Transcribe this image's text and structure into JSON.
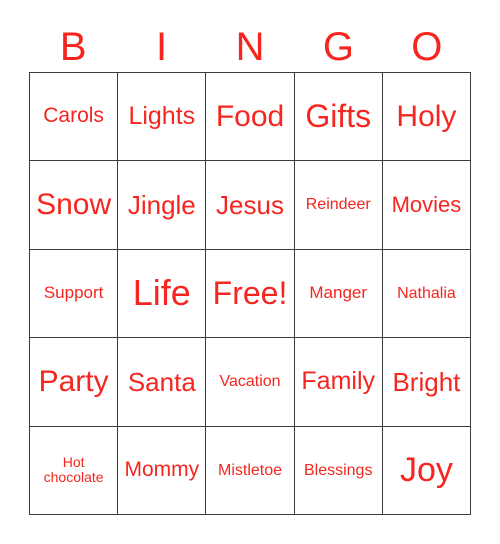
{
  "card": {
    "title": "BINGO Card",
    "text_color": "#f4261f",
    "border_color": "#3c3c3c",
    "background_color": "#ffffff",
    "header": {
      "letters": [
        "B",
        "I",
        "N",
        "G",
        "O"
      ]
    },
    "rows": [
      [
        {
          "label": "Carols",
          "size": "fs-md"
        },
        {
          "label": "Lights",
          "size": "fs-lg"
        },
        {
          "label": "Food",
          "size": "fs-xl"
        },
        {
          "label": "Gifts",
          "size": "fs-xxl"
        },
        {
          "label": "Holy",
          "size": "fs-xl"
        }
      ],
      [
        {
          "label": "Snow",
          "size": "fs-xl"
        },
        {
          "label": "Jingle",
          "size": "fs-lgp"
        },
        {
          "label": "Jesus",
          "size": "fs-lgp"
        },
        {
          "label": "Reindeer",
          "size": "fs-sm"
        },
        {
          "label": "Movies",
          "size": "fs-mdp"
        }
      ],
      [
        {
          "label": "Support",
          "size": "fs-smp"
        },
        {
          "label": "Life",
          "size": "fs-h2"
        },
        {
          "label": "Free!",
          "size": "fs-xxl"
        },
        {
          "label": "Manger",
          "size": "fs-smp"
        },
        {
          "label": "Nathalia",
          "size": "fs-sm"
        }
      ],
      [
        {
          "label": "Party",
          "size": "fs-xl"
        },
        {
          "label": "Santa",
          "size": "fs-lgp"
        },
        {
          "label": "Vacation",
          "size": "fs-sm"
        },
        {
          "label": "Family",
          "size": "fs-lg"
        },
        {
          "label": "Bright",
          "size": "fs-lgp"
        }
      ],
      [
        {
          "label": "Hot\nchocolate",
          "size": "fs-xs"
        },
        {
          "label": "Mommy",
          "size": "fs-md"
        },
        {
          "label": "Mistletoe",
          "size": "fs-sm"
        },
        {
          "label": "Blessings",
          "size": "fs-sm"
        },
        {
          "label": "Joy",
          "size": "fs-h1"
        }
      ]
    ]
  }
}
